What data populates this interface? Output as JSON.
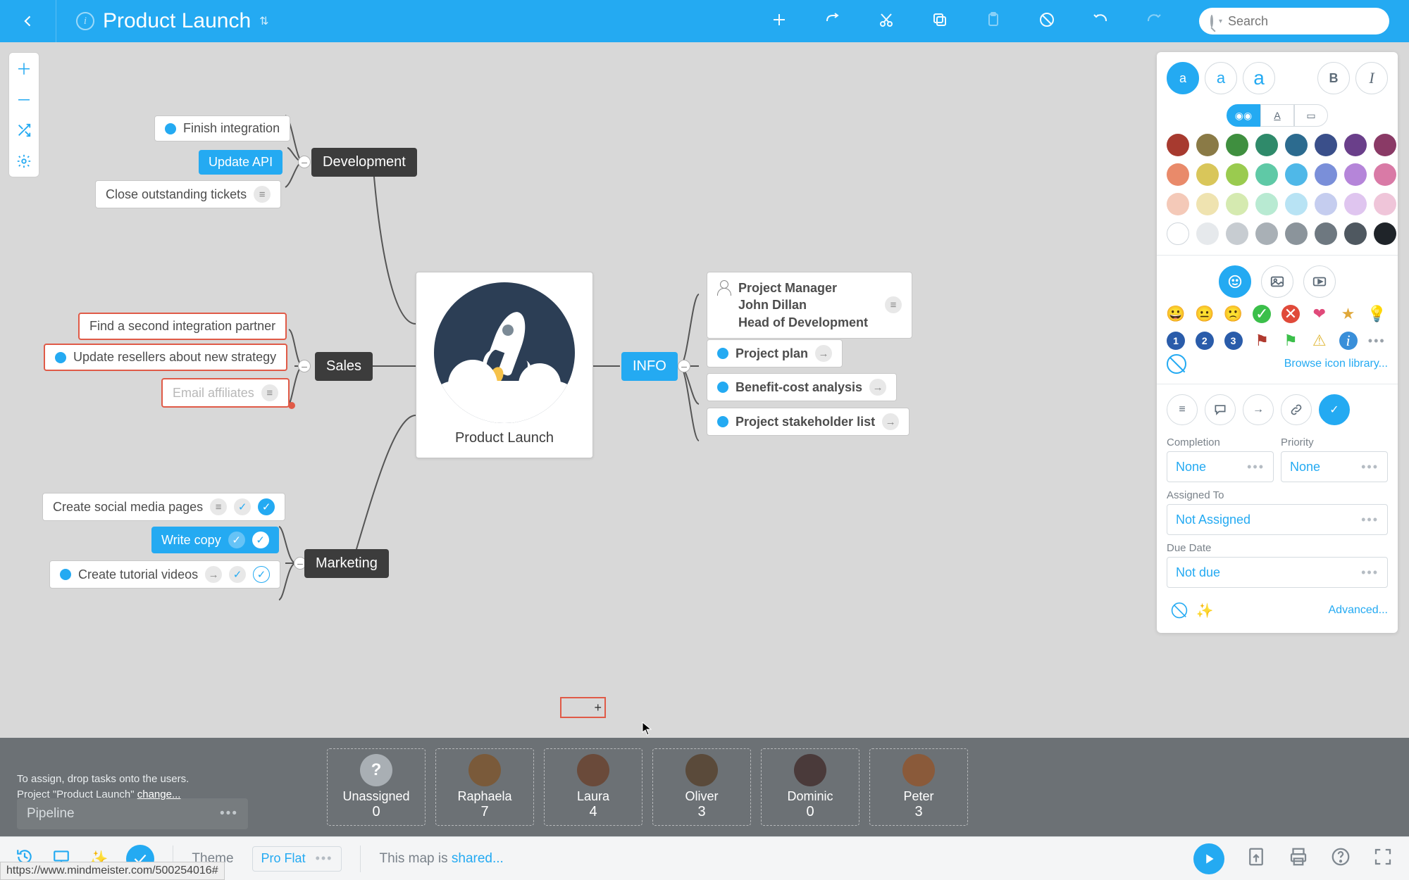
{
  "topbar": {
    "title": "Product Launch",
    "search_placeholder": "Search"
  },
  "central": {
    "title": "Product Launch"
  },
  "branches": {
    "development": "Development",
    "sales": "Sales",
    "marketing": "Marketing",
    "info": "INFO"
  },
  "dev": {
    "finish": "Finish integration",
    "update_api": "Update API",
    "close_tickets": "Close outstanding tickets"
  },
  "sales": {
    "find_partner": "Find a second integration partner",
    "update_resellers": "Update resellers about new strategy",
    "email_affiliates": "Email affiliates"
  },
  "marketing": {
    "social": "Create social media pages",
    "copy": "Write copy",
    "videos": "Create tutorial videos"
  },
  "info": {
    "pm_role": "Project Manager",
    "pm_name": "John Dillan",
    "pm_title": "Head of Development",
    "plan": "Project plan",
    "benefit": "Benefit-cost analysis",
    "stakeholders": "Project stakeholder list"
  },
  "panel": {
    "browse": "Browse icon library...",
    "completion_label": "Completion",
    "completion_value": "None",
    "priority_label": "Priority",
    "priority_value": "None",
    "assigned_label": "Assigned To",
    "assigned_value": "Not Assigned",
    "due_label": "Due Date",
    "due_value": "Not due",
    "advanced": "Advanced..."
  },
  "colors": {
    "row1": [
      "#a73a2f",
      "#8a7a46",
      "#3f8f3f",
      "#2f8a6a",
      "#2c6b8f",
      "#3a4f8a",
      "#6a3f8a",
      "#8a3a66"
    ],
    "row2": [
      "#e98a6a",
      "#d9c65a",
      "#9acb4f",
      "#5fc9a6",
      "#4fb8e8",
      "#7a8fd9",
      "#b585d9",
      "#d97aa6"
    ],
    "row3": [
      "#f4c9b8",
      "#efe3b0",
      "#d5eab0",
      "#b8ead2",
      "#b8e3f4",
      "#c5cdef",
      "#dfc5ef",
      "#efc5d9"
    ],
    "row4": [
      "#ffffff",
      "#e6e9ec",
      "#c7ccd1",
      "#a9b0b6",
      "#8b949b",
      "#6e7880",
      "#4f5860",
      "#1f2429"
    ]
  },
  "assign": {
    "hint_line1": "To assign, drop tasks onto the users.",
    "hint_line2_a": "Project \"Product Launch\" ",
    "hint_line2_b": "change...",
    "pipeline": "Pipeline",
    "people": [
      {
        "name": "Unassigned",
        "count": "0",
        "avatar": "?",
        "bg": "#a9afb4"
      },
      {
        "name": "Raphaela",
        "count": "7",
        "avatar": "",
        "bg": "#7a5a3a"
      },
      {
        "name": "Laura",
        "count": "4",
        "avatar": "",
        "bg": "#6a4a3a"
      },
      {
        "name": "Oliver",
        "count": "3",
        "avatar": "",
        "bg": "#5a4a3a"
      },
      {
        "name": "Dominic",
        "count": "0",
        "avatar": "",
        "bg": "#4a3a3a"
      },
      {
        "name": "Peter",
        "count": "3",
        "avatar": "",
        "bg": "#8a5a3a"
      }
    ]
  },
  "footer": {
    "theme_label": "Theme",
    "theme_value": "Pro Flat",
    "share_prefix": "This map is ",
    "share_link": "shared..."
  },
  "status_url": "https://www.mindmeister.com/500254016#"
}
